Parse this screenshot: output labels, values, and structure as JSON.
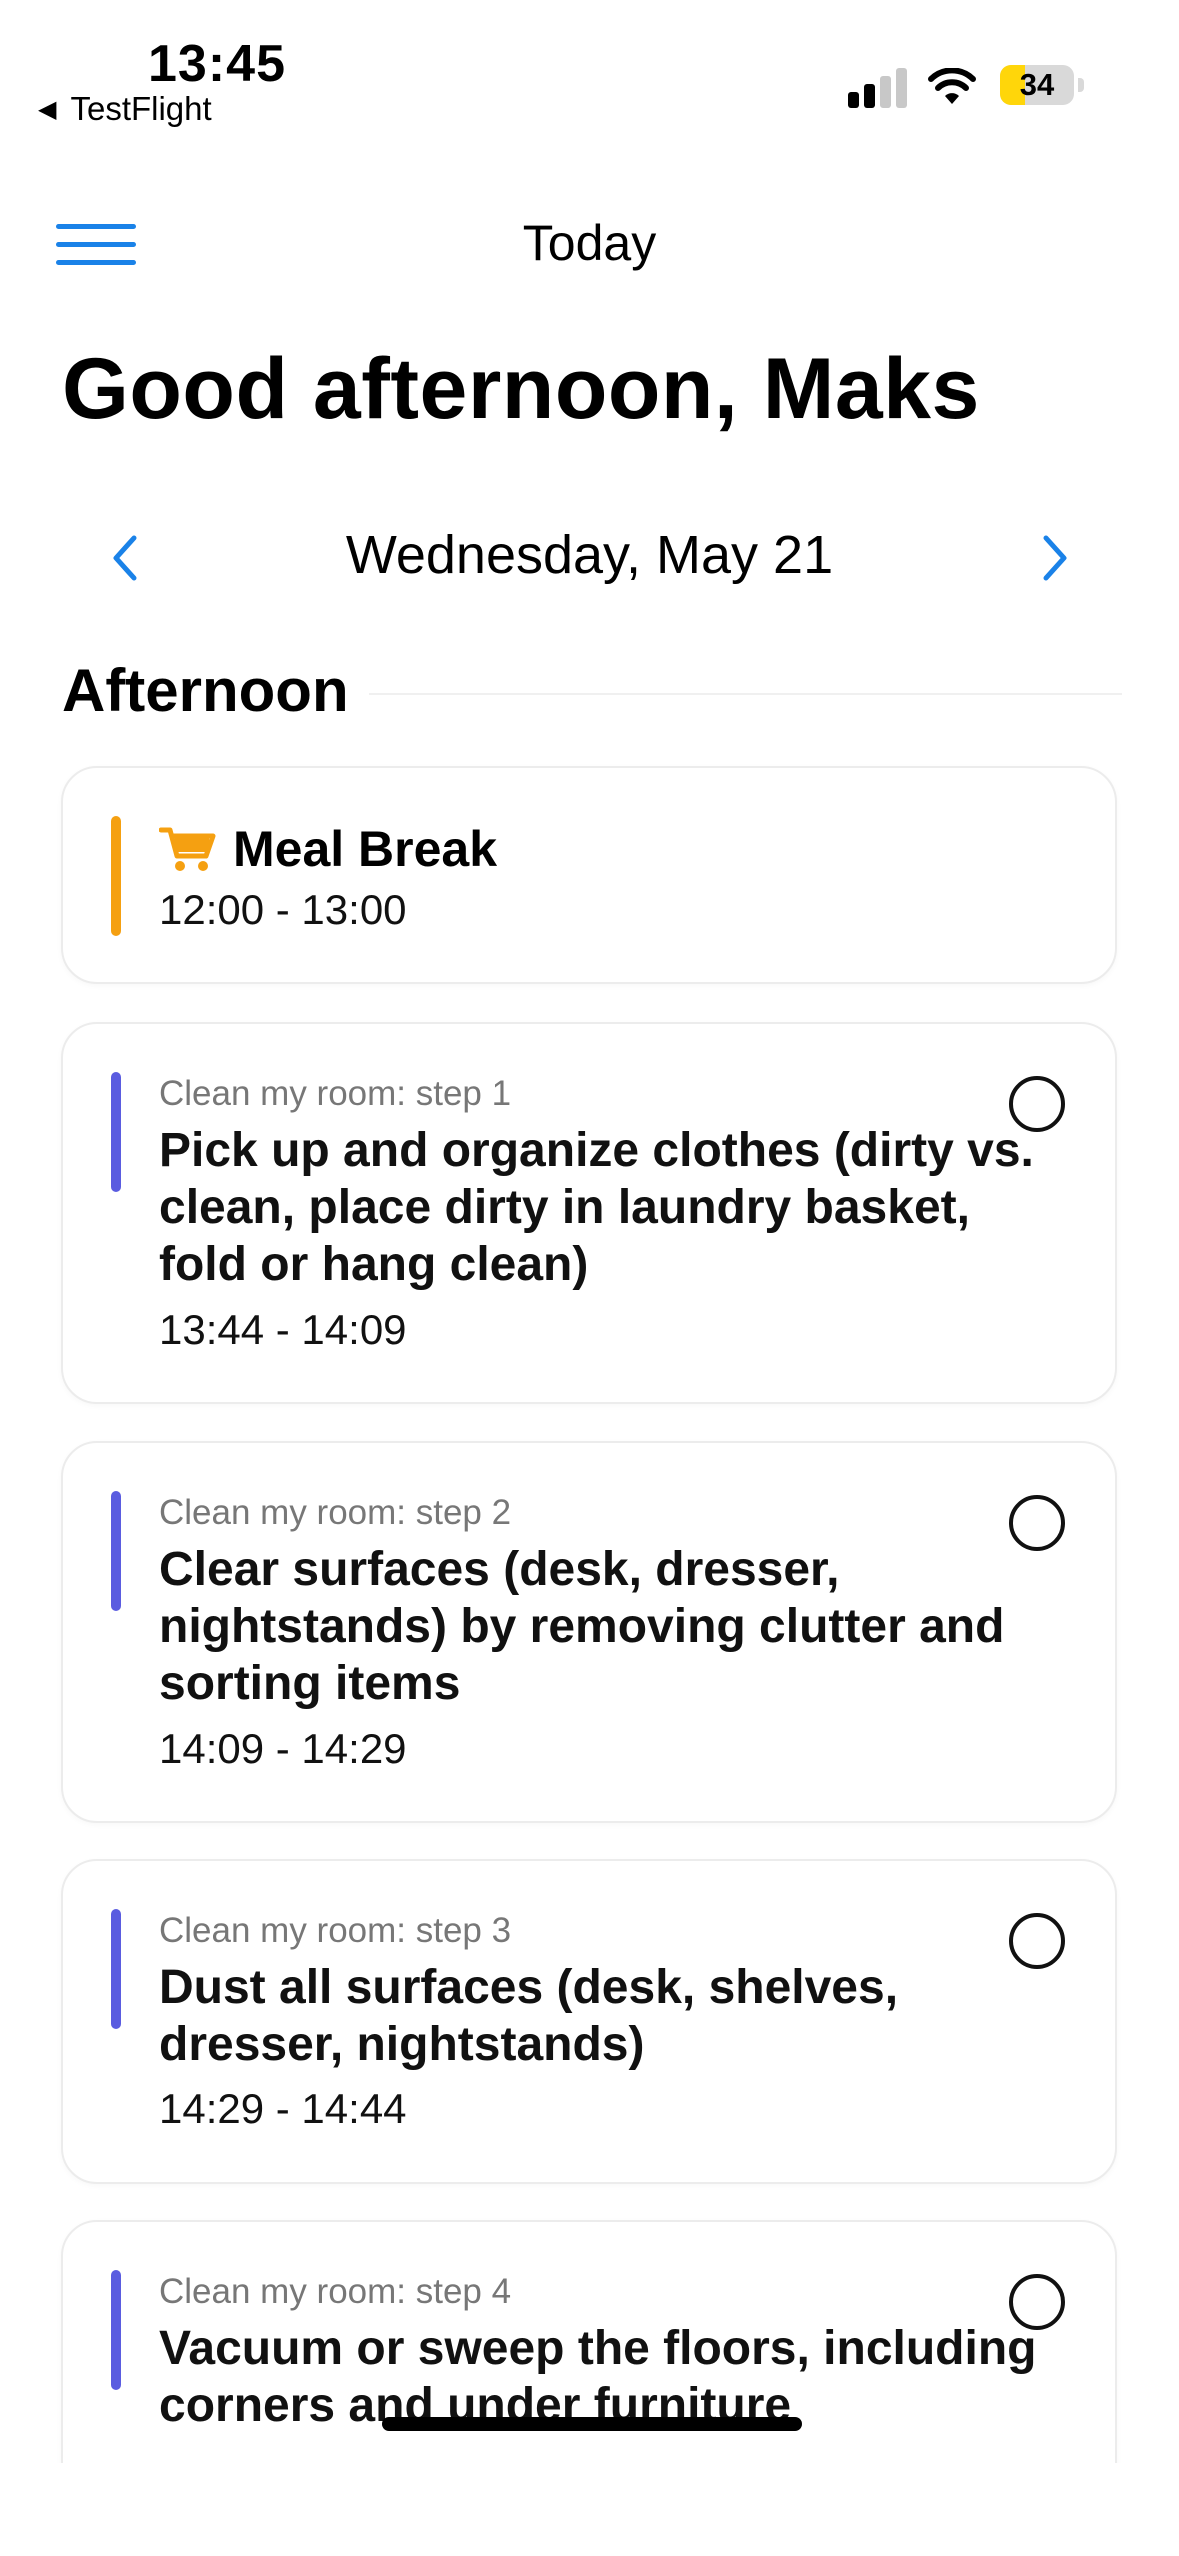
{
  "status_bar": {
    "time": "13:45",
    "back_app": "TestFlight",
    "battery_percent": "34",
    "battery_level": 0.34,
    "battery_color": "#ffd60a"
  },
  "nav": {
    "title": "Today",
    "accent_color": "#1a82e8"
  },
  "greeting": "Good afternoon, Maks",
  "date_nav": {
    "date": "Wednesday, May 21"
  },
  "section": {
    "title": "Afternoon"
  },
  "cards": [
    {
      "type": "event",
      "title": "Meal Break",
      "time": "12:00 - 13:00",
      "icon": "cart-icon",
      "accent_color": "#f5a011"
    },
    {
      "type": "task",
      "subtitle": "Clean my room: step 1",
      "title": "Pick up and organize clothes (dirty vs. clean, place dirty in laundry basket, fold or hang clean)",
      "time": "13:44 - 14:09",
      "accent_color": "#5a5ce0",
      "completed": false
    },
    {
      "type": "task",
      "subtitle": "Clean my room: step 2",
      "title": "Clear surfaces (desk, dresser, nightstands) by removing clutter and sorting items",
      "time": "14:09 - 14:29",
      "accent_color": "#5a5ce0",
      "completed": false
    },
    {
      "type": "task",
      "subtitle": "Clean my room: step 3",
      "title": "Dust all surfaces (desk, shelves, dresser, nightstands)",
      "time": "14:29 - 14:44",
      "accent_color": "#5a5ce0",
      "completed": false
    },
    {
      "type": "task",
      "subtitle": "Clean my room: step 4",
      "title": "Vacuum or sweep the floors, including corners and under furniture",
      "time": "",
      "accent_color": "#5a5ce0",
      "completed": false
    }
  ]
}
